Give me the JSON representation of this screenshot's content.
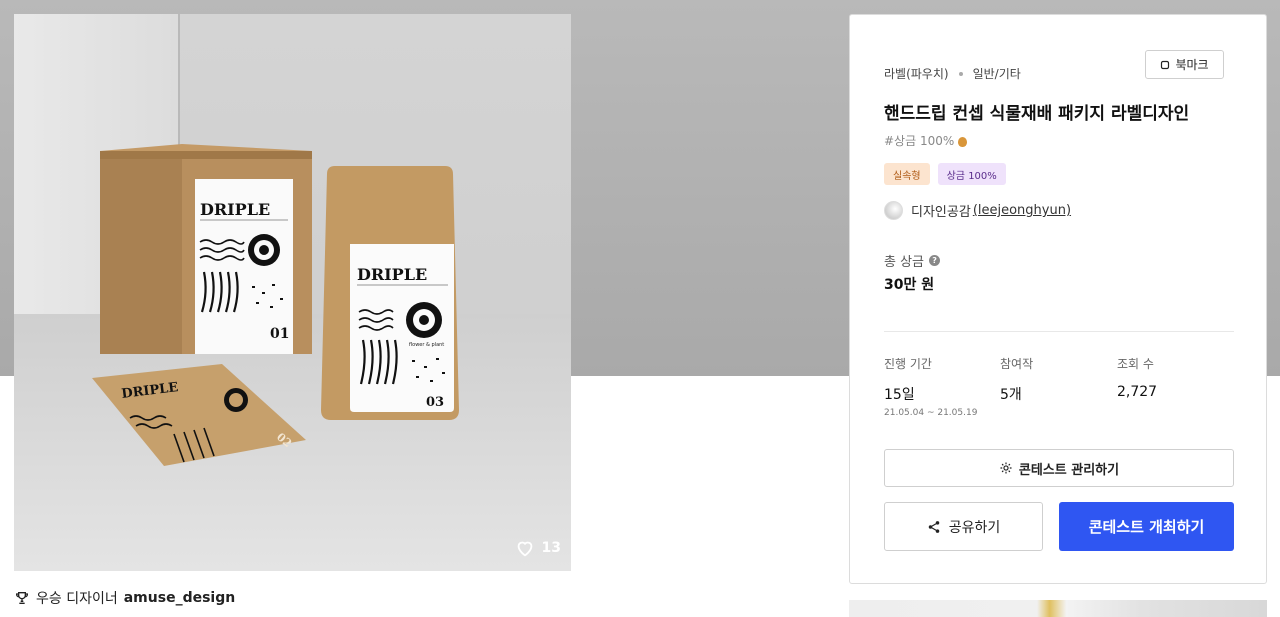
{
  "design": {
    "likes": "13",
    "credit_prefix": "우승 디자이너",
    "credit_name": "amuse_design",
    "label_brand": "DRIPLE",
    "label_subtitle": "flower & plant",
    "box_number": "01",
    "pouch_number": "03",
    "card_number": "02"
  },
  "contest": {
    "category": "라벨(파우치)",
    "subcategory": "일반/기타",
    "bookmark_label": "북마크",
    "title": "핸드드립 컨셉 식물재배 패키지 라벨디자인",
    "tagline": "#상금 100%",
    "badges": [
      "실속형",
      "상금 100%"
    ],
    "host_name": "디자인공감",
    "host_handle": "(leejeonghyun)",
    "prize_label": "총 상금",
    "prize_help": "?",
    "prize_value": "30만 원",
    "stats": {
      "period_label": "진행 기간",
      "period_value": "15일",
      "period_range": "21.05.04 ~ 21.05.19",
      "entries_label": "참여작",
      "entries_value": "5개",
      "views_label": "조회 수",
      "views_value": "2,727"
    },
    "manage_label": "콘테스트 관리하기",
    "share_label": "공유하기",
    "host_contest_label": "콘테스트 개최하기"
  },
  "colors": {
    "primary": "#2f56f2",
    "badge_orange_bg": "#fce4cf",
    "badge_purple_bg": "#efe2fb"
  },
  "icons": [
    "heart-icon",
    "trophy-icon",
    "bookmark-icon",
    "gear-icon",
    "share-icon",
    "moneybag-icon",
    "help-icon"
  ]
}
